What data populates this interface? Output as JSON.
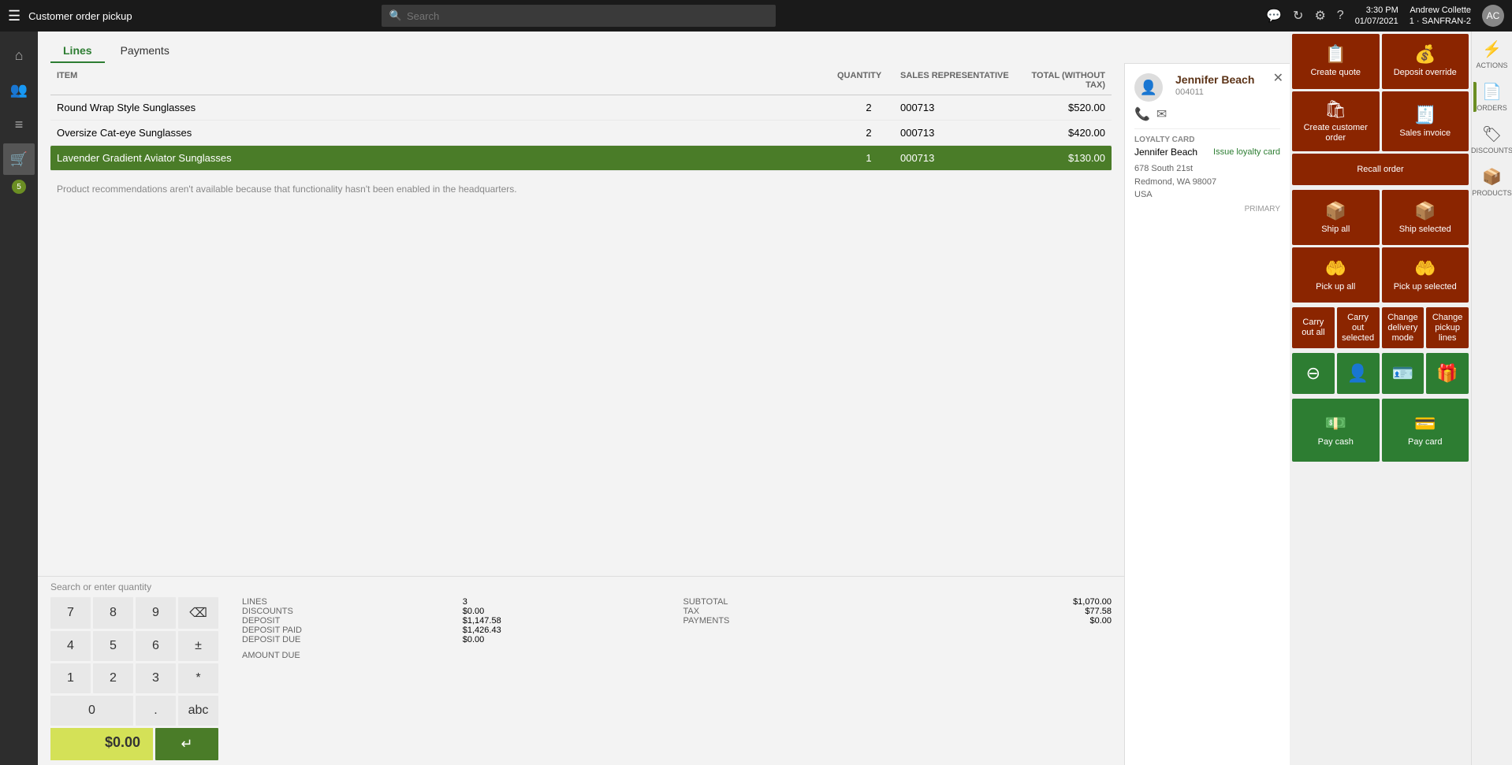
{
  "topbar": {
    "hamburger": "☰",
    "title": "Customer order pickup",
    "search_placeholder": "Search",
    "time": "3:30 PM",
    "date": "01/07/2021",
    "store": "1 · SANFRAN-2",
    "username": "Andrew Collette",
    "icons": {
      "chat": "💬",
      "refresh": "↻",
      "settings": "⚙",
      "help": "?"
    }
  },
  "tabs": [
    {
      "id": "lines",
      "label": "Lines",
      "active": true
    },
    {
      "id": "payments",
      "label": "Payments",
      "active": false
    }
  ],
  "table": {
    "columns": [
      "ITEM",
      "QUANTITY",
      "SALES REPRESENTATIVE",
      "TOTAL (WITHOUT TAX)"
    ],
    "rows": [
      {
        "item": "Round Wrap Style Sunglasses",
        "quantity": "2",
        "sales_rep": "000713",
        "total": "$520.00",
        "selected": false
      },
      {
        "item": "Oversize Cat-eye Sunglasses",
        "quantity": "2",
        "sales_rep": "000713",
        "total": "$420.00",
        "selected": false
      },
      {
        "item": "Lavender Gradient Aviator Sunglasses",
        "quantity": "1",
        "sales_rep": "000713",
        "total": "$130.00",
        "selected": true
      }
    ]
  },
  "recommendation_note": "Product recommendations aren't available because that functionality hasn't been enabled in the headquarters.",
  "summary": {
    "lines_label": "LINES",
    "lines_value": "3",
    "discounts_label": "DISCOUNTS",
    "discounts_value": "$0.00",
    "deposit_label": "DEPOSIT",
    "deposit_value": "$1,147.58",
    "deposit_paid_label": "DEPOSIT PAID",
    "deposit_paid_value": "$1,426.43",
    "deposit_due_label": "DEPOSIT DUE",
    "deposit_due_value": "$0.00",
    "subtotal_label": "SUBTOTAL",
    "subtotal_value": "$1,070.00",
    "tax_label": "TAX",
    "tax_value": "$77.58",
    "payments_label": "PAYMENTS",
    "payments_value": "$0.00",
    "amount_due_label": "AMOUNT DUE",
    "amount_due_value": "$0.00"
  },
  "numpad": {
    "search_label": "Search or enter quantity",
    "keys": [
      "7",
      "8",
      "9",
      "⌫",
      "4",
      "5",
      "6",
      "±",
      "1",
      "2",
      "3",
      "*",
      "0",
      ".",
      "abc"
    ]
  },
  "customer": {
    "name": "Jennifer Beach",
    "id": "004011",
    "address_line1": "678 South 21st",
    "address_line2": "Redmond, WA 98007",
    "address_line3": "USA",
    "loyalty_card_label": "LOYALTY CARD",
    "loyalty_card_name": "Jennifer Beach",
    "issue_loyalty_card": "Issue loyalty card",
    "primary_label": "PRIMARY"
  },
  "action_buttons": {
    "create_quote": "Create quote",
    "deposit_override": "Deposit override",
    "create_customer_order": "Create customer order",
    "sales_invoice": "Sales invoice",
    "recall_order": "Recall order",
    "ship_all": "Ship all",
    "ship_selected": "Ship selected",
    "pick_up_all": "Pick up all",
    "pick_up_selected": "Pick up selected",
    "carry_out_all": "Carry out all",
    "carry_out_selected": "Carry out selected",
    "change_delivery_mode": "Change delivery mode",
    "change_pickup_lines": "Change pickup lines",
    "pay_cash": "Pay cash",
    "pay_card": "Pay card"
  },
  "sidebar_right": {
    "actions_label": "ACTIONS",
    "orders_label": "ORDERS",
    "discounts_label": "DISCOUNTS",
    "products_label": "PRODUCTS"
  },
  "sidebar_left": {
    "badge": "5"
  }
}
